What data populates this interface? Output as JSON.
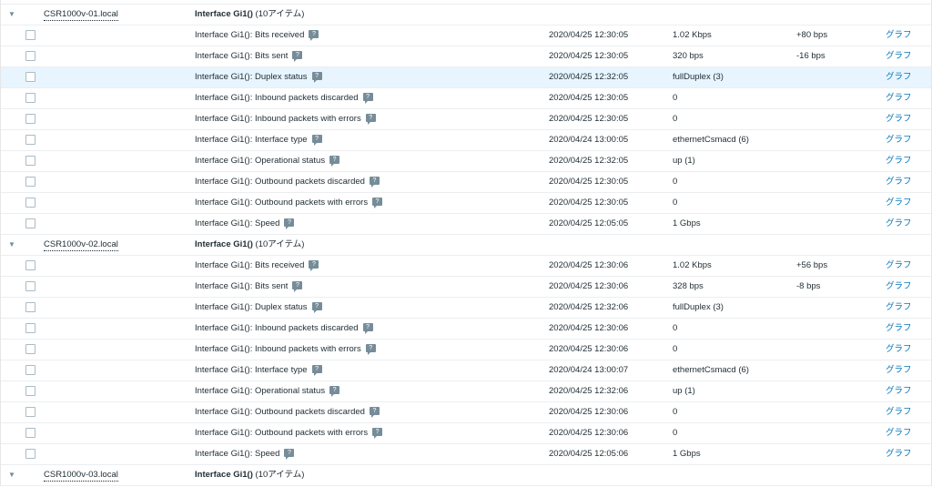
{
  "graph_label": "グラフ",
  "groups": [
    {
      "host": "CSR1000v-01.local",
      "application": "Interface Gi1()",
      "count": "(10アイテム)",
      "items": [
        {
          "name": "Interface Gi1(): Bits received",
          "time": "2020/04/25 12:30:05",
          "value": "1.02 Kbps",
          "change": "+80 bps"
        },
        {
          "name": "Interface Gi1(): Bits sent",
          "time": "2020/04/25 12:30:05",
          "value": "320 bps",
          "change": "-16 bps"
        },
        {
          "name": "Interface Gi1(): Duplex status",
          "time": "2020/04/25 12:32:05",
          "value": "fullDuplex (3)",
          "change": ""
        },
        {
          "name": "Interface Gi1(): Inbound packets discarded",
          "time": "2020/04/25 12:30:05",
          "value": "0",
          "change": ""
        },
        {
          "name": "Interface Gi1(): Inbound packets with errors",
          "time": "2020/04/25 12:30:05",
          "value": "0",
          "change": ""
        },
        {
          "name": "Interface Gi1(): Interface type",
          "time": "2020/04/24 13:00:05",
          "value": "ethernetCsmacd (6)",
          "change": ""
        },
        {
          "name": "Interface Gi1(): Operational status",
          "time": "2020/04/25 12:32:05",
          "value": "up (1)",
          "change": ""
        },
        {
          "name": "Interface Gi1(): Outbound packets discarded",
          "time": "2020/04/25 12:30:05",
          "value": "0",
          "change": ""
        },
        {
          "name": "Interface Gi1(): Outbound packets with errors",
          "time": "2020/04/25 12:30:05",
          "value": "0",
          "change": ""
        },
        {
          "name": "Interface Gi1(): Speed",
          "time": "2020/04/25 12:05:05",
          "value": "1 Gbps",
          "change": ""
        }
      ]
    },
    {
      "host": "CSR1000v-02.local",
      "application": "Interface Gi1()",
      "count": "(10アイテム)",
      "items": [
        {
          "name": "Interface Gi1(): Bits received",
          "time": "2020/04/25 12:30:06",
          "value": "1.02 Kbps",
          "change": "+56 bps"
        },
        {
          "name": "Interface Gi1(): Bits sent",
          "time": "2020/04/25 12:30:06",
          "value": "328 bps",
          "change": "-8 bps"
        },
        {
          "name": "Interface Gi1(): Duplex status",
          "time": "2020/04/25 12:32:06",
          "value": "fullDuplex (3)",
          "change": ""
        },
        {
          "name": "Interface Gi1(): Inbound packets discarded",
          "time": "2020/04/25 12:30:06",
          "value": "0",
          "change": ""
        },
        {
          "name": "Interface Gi1(): Inbound packets with errors",
          "time": "2020/04/25 12:30:06",
          "value": "0",
          "change": ""
        },
        {
          "name": "Interface Gi1(): Interface type",
          "time": "2020/04/24 13:00:07",
          "value": "ethernetCsmacd (6)",
          "change": ""
        },
        {
          "name": "Interface Gi1(): Operational status",
          "time": "2020/04/25 12:32:06",
          "value": "up (1)",
          "change": ""
        },
        {
          "name": "Interface Gi1(): Outbound packets discarded",
          "time": "2020/04/25 12:30:06",
          "value": "0",
          "change": ""
        },
        {
          "name": "Interface Gi1(): Outbound packets with errors",
          "time": "2020/04/25 12:30:06",
          "value": "0",
          "change": ""
        },
        {
          "name": "Interface Gi1(): Speed",
          "time": "2020/04/25 12:05:06",
          "value": "1 Gbps",
          "change": ""
        }
      ]
    },
    {
      "host": "CSR1000v-03.local",
      "application": "Interface Gi1()",
      "count": "(10アイテム)",
      "items": []
    }
  ]
}
